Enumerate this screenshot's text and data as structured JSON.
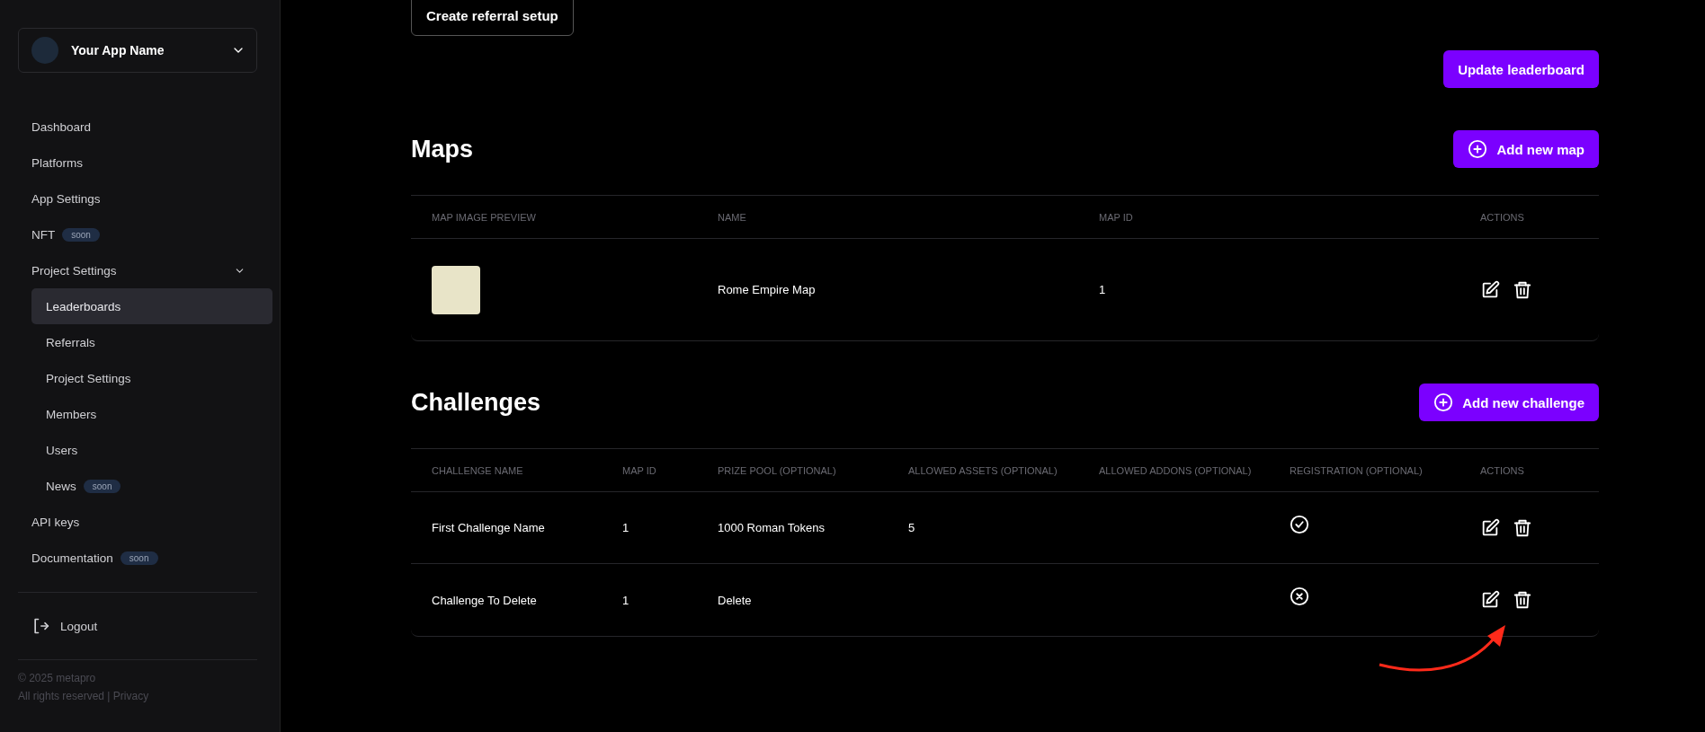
{
  "sidebar": {
    "app_selector": {
      "name": "Your App Name"
    },
    "nav": [
      {
        "label": "Dashboard",
        "selected": false
      },
      {
        "label": "Platforms",
        "selected": false
      },
      {
        "label": "App Settings",
        "selected": false
      },
      {
        "label": "NFT",
        "badge": "soon",
        "selected": false
      },
      {
        "label": "Project Settings",
        "expanded": true,
        "selected": false,
        "children": [
          {
            "label": "Leaderboards",
            "selected": true
          },
          {
            "label": "Referrals",
            "selected": false
          },
          {
            "label": "Project Settings",
            "selected": false
          },
          {
            "label": "Members",
            "selected": false
          },
          {
            "label": "Users",
            "selected": false
          },
          {
            "label": "News",
            "badge": "soon",
            "selected": false
          }
        ]
      },
      {
        "label": "API keys",
        "selected": false
      },
      {
        "label": "Documentation",
        "badge": "soon",
        "selected": false
      }
    ],
    "logout": "Logout",
    "footer": {
      "copyright": "© 2025 metapro",
      "rights": "All rights reserved |",
      "privacy": "Privacy"
    }
  },
  "main": {
    "top_button": "Create referral setup",
    "update_button": "Update leaderboard",
    "maps": {
      "title": "Maps",
      "add_button": "Add new map",
      "columns": [
        "MAP IMAGE PREVIEW",
        "NAME",
        "MAP ID",
        "ACTIONS"
      ],
      "rows": [
        {
          "name": "Rome Empire Map",
          "map_id": "1"
        }
      ]
    },
    "challenges": {
      "title": "Challenges",
      "add_button": "Add new challenge",
      "columns": [
        "CHALLENGE NAME",
        "MAP ID",
        "PRIZE POOL (OPTIONAL)",
        "ALLOWED ASSETS (OPTIONAL)",
        "ALLOWED ADDONS (OPTIONAL)",
        "REGISTRATION (OPTIONAL)",
        "ACTIONS"
      ],
      "rows": [
        {
          "name": "First Challenge Name",
          "map_id": "1",
          "prize_pool": "1000 Roman Tokens",
          "allowed_assets": "5",
          "registration": true
        },
        {
          "name": "Challenge To Delete",
          "map_id": "1",
          "prize_pool": "Delete",
          "allowed_assets": "",
          "registration": false
        }
      ]
    }
  }
}
